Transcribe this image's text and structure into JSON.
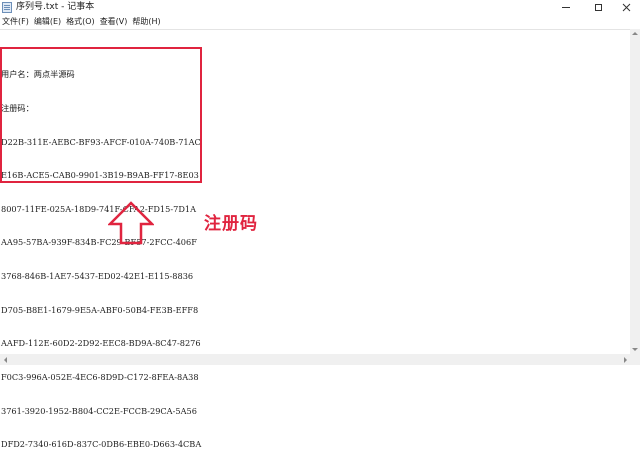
{
  "window": {
    "title": "序列号.txt - 记事本",
    "icon": "notepad-icon"
  },
  "menu": [
    {
      "label": "文件(F)"
    },
    {
      "label": "编辑(E)"
    },
    {
      "label": "格式(O)"
    },
    {
      "label": "查看(V)"
    },
    {
      "label": "帮助(H)"
    }
  ],
  "document": {
    "lines": [
      "用户名：两点半源码",
      "注册码：",
      "D22B-311E-AEBC-BF93-AFCF-010A-740B-71AC",
      "E16B-ACE5-CAB0-9901-3B19-B9AB-FF17-8E03",
      "8007-11FE-025A-18D9-741F-CFA2-FD15-7D1A",
      "AA95-57BA-939F-834B-FC29-BF57-2FCC-406F",
      "3768-846B-1AE7-5437-ED02-42E1-E115-8836",
      "D705-B8E1-1679-9E5A-ABF0-50B4-FE3B-EFF8",
      "AAFD-112E-60D2-2D92-EEC8-BD9A-8C47-8276",
      "F0C3-996A-052E-4EC6-8D9D-C172-8FEA-8A38",
      "3761-3920-1952-B804-CC2E-FCCB-29CA-5A56",
      "DFD2-7340-616D-837C-0DB6-EBE0-D663-4CBA"
    ]
  },
  "annotation": {
    "label": "注册码",
    "color": "#e0243f",
    "arrow_icon": "up-arrow-icon"
  }
}
